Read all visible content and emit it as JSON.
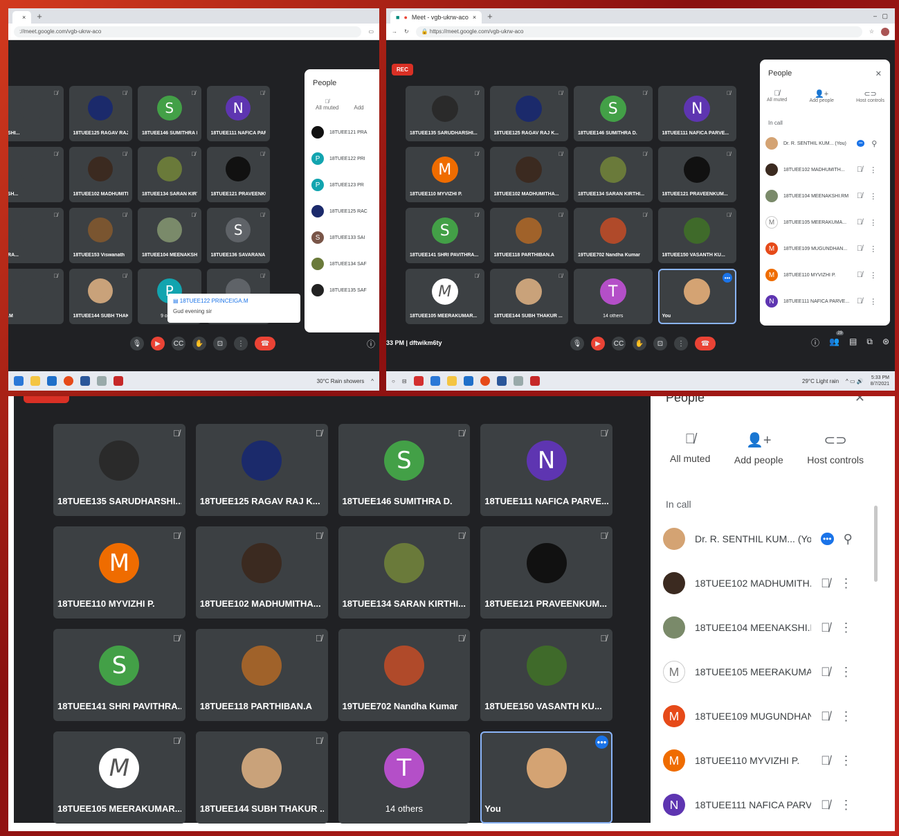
{
  "shot1": {
    "tab_title": "",
    "url": "://meet.google.com/vgb-ukrw-aco",
    "tiles": [
      {
        "name": "RSHI...",
        "av": "",
        "color": "#3c4043"
      },
      {
        "name": "18TUEE125 RAGAV RAJ K...",
        "av": "",
        "color": "#1b2a6b"
      },
      {
        "name": "18TUEE146 SUMITHRA D.",
        "av": "S",
        "color": "#43a047"
      },
      {
        "name": "18TUEE111 NAFICA PARVE...",
        "av": "N",
        "color": "#5e35b1"
      },
      {
        "name": "ESH...",
        "av": "",
        "color": "#3c4043"
      },
      {
        "name": "18TUEE102 MADHUMITHA...",
        "av": "",
        "color": "#3b2a20"
      },
      {
        "name": "18TUEE134 SARAN KIRTHI...",
        "av": "",
        "color": "#6a7a3a"
      },
      {
        "name": "18TUEE121 PRAVEENKUM...",
        "av": "",
        "color": "#111"
      },
      {
        "name": "HRA...",
        "av": "",
        "color": "#3c4043"
      },
      {
        "name": "18TUEE153 Viswanath",
        "av": "",
        "color": "#7a5530"
      },
      {
        "name": "18TUEE104 MEENAKSHI.RM",
        "av": "",
        "color": "#7a8a6a"
      },
      {
        "name": "18TUEE136 SAVARANA S",
        "av": "S",
        "color": "#5f6368"
      },
      {
        "name": "A.M",
        "av": "",
        "color": "#3c4043"
      },
      {
        "name": "18TUEE144 SUBH THAKUR ...",
        "av": "",
        "color": "#c9a27a"
      },
      {
        "name": "9 others",
        "av": "P",
        "color": "#12a4af"
      },
      {
        "name": "",
        "av": "",
        "color": "#5f6368"
      }
    ],
    "chat_sender": "18TUEE122 PRINCEIGA.M",
    "chat_message": "Gud evening sir",
    "people_title": "People",
    "all_muted": "All muted",
    "add": "Add",
    "people": [
      {
        "name": "18TUEE121 PRA",
        "av": "",
        "color": "#111"
      },
      {
        "name": "18TUEE122 PRI",
        "av": "P",
        "color": "#12a4af"
      },
      {
        "name": "18TUEE123 PR",
        "av": "P",
        "color": "#12a4af"
      },
      {
        "name": "18TUEE125 RAC",
        "av": "",
        "color": "#1b2a6b"
      },
      {
        "name": "18TUEE133 SAI",
        "av": "S",
        "color": "#795548"
      },
      {
        "name": "18TUEE134 SAF",
        "av": "",
        "color": "#6a7a3a"
      },
      {
        "name": "18TUEE135 SAF",
        "av": "",
        "color": "#222"
      }
    ],
    "weather": "30°C  Rain showers"
  },
  "shot2": {
    "tab_title": "Meet - vgb-ukrw-aco",
    "url": "https://meet.google.com/vgb-ukrw-aco",
    "rec": "REC",
    "tiles": [
      {
        "name": "18TUEE135 SARUDHARSHI...",
        "av": "",
        "color": "#2a2a2a"
      },
      {
        "name": "18TUEE125 RAGAV RAJ K...",
        "av": "",
        "color": "#1b2a6b"
      },
      {
        "name": "18TUEE146 SUMITHRA D.",
        "av": "S",
        "color": "#43a047"
      },
      {
        "name": "18TUEE111 NAFICA PARVE...",
        "av": "N",
        "color": "#5e35b1"
      },
      {
        "name": "18TUEE110 MYVIZHI P.",
        "av": "M",
        "color": "#ef6c00"
      },
      {
        "name": "18TUEE102 MADHUMITHA...",
        "av": "",
        "color": "#3b2a20"
      },
      {
        "name": "18TUEE134 SARAN KIRTHI...",
        "av": "",
        "color": "#6a7a3a"
      },
      {
        "name": "18TUEE121 PRAVEENKUM...",
        "av": "",
        "color": "#111"
      },
      {
        "name": "18TUEE141 SHRI PAVITHRA...",
        "av": "S",
        "color": "#43a047"
      },
      {
        "name": "18TUEE118 PARTHIBAN.A",
        "av": "",
        "color": "#a0622a"
      },
      {
        "name": "19TUEE702 Nandha Kumar",
        "av": "",
        "color": "#b04a2a"
      },
      {
        "name": "18TUEE150 VASANTH KU...",
        "av": "",
        "color": "#3f6a2a"
      },
      {
        "name": "18TUEE105 MEERAKUMAR...",
        "av": "M",
        "color": "#ffffff"
      },
      {
        "name": "18TUEE144 SUBH THAKUR ...",
        "av": "",
        "color": "#c9a27a"
      },
      {
        "name": "14 others",
        "av": "T",
        "color": "#b44fc8"
      },
      {
        "name": "You",
        "av": "",
        "color": "#d4a373"
      }
    ],
    "time_code": "33 PM  |  dftwikm6ty",
    "people_title": "People",
    "all_muted": "All muted",
    "add_people": "Add people",
    "host_controls": "Host controls",
    "in_call": "In call",
    "people": [
      {
        "name": "Dr. R. SENTHIL KUM...  (You)",
        "av": "",
        "color": "#d4a373"
      },
      {
        "name": "18TUEE102 MADHUMITH...",
        "av": "",
        "color": "#3b2a20"
      },
      {
        "name": "18TUEE104 MEENAKSHI.RM",
        "av": "",
        "color": "#7a8a6a"
      },
      {
        "name": "18TUEE105 MEERAKUMA...",
        "av": "M",
        "color": "#ffffff"
      },
      {
        "name": "18TUEE109 MUGUNDHAN...",
        "av": "M",
        "color": "#e64a19"
      },
      {
        "name": "18TUEE110 MYVIZHI P.",
        "av": "M",
        "color": "#ef6c00"
      },
      {
        "name": "18TUEE111 NAFICA PARVE...",
        "av": "N",
        "color": "#5e35b1"
      }
    ],
    "participant_count": "29",
    "weather": "29°C  Light rain",
    "clock_time": "5:33 PM",
    "clock_date": "8/7/2021"
  },
  "shot3": {
    "tiles": [
      {
        "name": "18TUEE135 SARUDHARSHI...",
        "av": "",
        "color": "#2a2a2a"
      },
      {
        "name": "18TUEE125 RAGAV RAJ K...",
        "av": "",
        "color": "#1b2a6b"
      },
      {
        "name": "18TUEE146 SUMITHRA D.",
        "av": "S",
        "color": "#43a047"
      },
      {
        "name": "18TUEE111 NAFICA PARVE...",
        "av": "N",
        "color": "#5e35b1"
      },
      {
        "name": "18TUEE110 MYVIZHI P.",
        "av": "M",
        "color": "#ef6c00"
      },
      {
        "name": "18TUEE102 MADHUMITHA...",
        "av": "",
        "color": "#3b2a20"
      },
      {
        "name": "18TUEE134 SARAN KIRTHI...",
        "av": "",
        "color": "#6a7a3a"
      },
      {
        "name": "18TUEE121 PRAVEENKUM...",
        "av": "",
        "color": "#111"
      },
      {
        "name": "18TUEE141 SHRI PAVITHRA...",
        "av": "S",
        "color": "#43a047"
      },
      {
        "name": "18TUEE118 PARTHIBAN.A",
        "av": "",
        "color": "#a0622a"
      },
      {
        "name": "19TUEE702 Nandha Kumar",
        "av": "",
        "color": "#b04a2a"
      },
      {
        "name": "18TUEE150 VASANTH KU...",
        "av": "",
        "color": "#3f6a2a"
      },
      {
        "name": "18TUEE105 MEERAKUMAR...",
        "av": "M",
        "color": "#ffffff"
      },
      {
        "name": "18TUEE144 SUBH THAKUR ...",
        "av": "",
        "color": "#c9a27a"
      },
      {
        "name": "14 others",
        "av": "T",
        "color": "#b44fc8"
      },
      {
        "name": "You",
        "av": "",
        "color": "#d4a373"
      }
    ],
    "people_title": "People",
    "all_muted": "All muted",
    "add_people": "Add people",
    "host_controls": "Host controls",
    "in_call": "In call",
    "people": [
      {
        "name": "Dr. R. SENTHIL KUM...  (You)",
        "av": "",
        "color": "#d4a373"
      },
      {
        "name": "18TUEE102 MADHUMITH...",
        "av": "",
        "color": "#3b2a20"
      },
      {
        "name": "18TUEE104 MEENAKSHI.RM",
        "av": "",
        "color": "#7a8a6a"
      },
      {
        "name": "18TUEE105 MEERAKUMA...",
        "av": "M",
        "color": "#ffffff"
      },
      {
        "name": "18TUEE109 MUGUNDHAN...",
        "av": "M",
        "color": "#e64a19"
      },
      {
        "name": "18TUEE110 MYVIZHI P.",
        "av": "M",
        "color": "#ef6c00"
      },
      {
        "name": "18TUEE111 NAFICA PARVE...",
        "av": "N",
        "color": "#5e35b1"
      }
    ]
  }
}
